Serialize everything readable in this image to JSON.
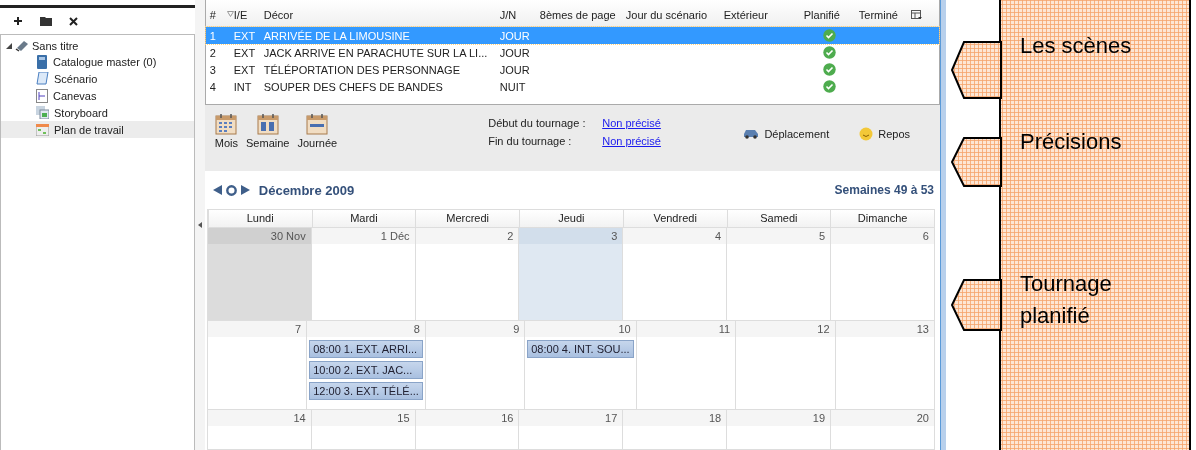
{
  "sidebar": {
    "tree": [
      {
        "label": "Sans titre",
        "expanded": true,
        "selected": false,
        "children": [
          {
            "label": "Catalogue master (0)",
            "kind": "catalog",
            "selected": false
          },
          {
            "label": "Scénario",
            "kind": "script",
            "selected": false
          },
          {
            "label": "Canevas",
            "kind": "canvas",
            "selected": false
          },
          {
            "label": "Storyboard",
            "kind": "storyboard",
            "selected": false
          },
          {
            "label": "Plan de travail",
            "kind": "schedule",
            "selected": true
          }
        ]
      }
    ]
  },
  "scenes": {
    "columns": [
      "#",
      "I/E",
      "Décor",
      "J/N",
      "8èmes de page",
      "Jour du scénario",
      "Extérieur",
      "Planifié",
      "Terminé"
    ],
    "rows": [
      {
        "number": "1",
        "ie": "EXT",
        "decor": "ARRIVÉE DE LA LIMOUSINE",
        "jn": "JOUR",
        "planned": true,
        "selected": true
      },
      {
        "number": "2",
        "ie": "EXT",
        "decor": "JACK ARRIVE EN PARACHUTE SUR LA LI...",
        "jn": "JOUR",
        "planned": true,
        "selected": false
      },
      {
        "number": "3",
        "ie": "EXT",
        "decor": "TÉLÉPORTATION DES PERSONNAGE",
        "jn": "JOUR",
        "planned": true,
        "selected": false
      },
      {
        "number": "4",
        "ie": "INT",
        "decor": "SOUPER DES CHEFS DE BANDES",
        "jn": "NUIT",
        "planned": true,
        "selected": false
      }
    ]
  },
  "toolbar": {
    "views": [
      {
        "label": "Mois",
        "kind": "month"
      },
      {
        "label": "Semaine",
        "kind": "week"
      },
      {
        "label": "Journée",
        "kind": "day"
      }
    ],
    "dates": [
      {
        "label": "Début du tournage :",
        "value": "Non précisé"
      },
      {
        "label": "Fin du tournage :",
        "value": "Non précisé"
      }
    ],
    "legend": [
      {
        "label": "Déplacement",
        "kind": "travel"
      },
      {
        "label": "Repos",
        "kind": "rest"
      }
    ]
  },
  "calendar": {
    "month": "Décembre 2009",
    "weeks_label": "Semaines 49 à 53",
    "days": [
      "Lundi",
      "Mardi",
      "Mercredi",
      "Jeudi",
      "Vendredi",
      "Samedi",
      "Dimanche"
    ],
    "weeks": [
      {
        "cells": [
          {
            "date": "30 Nov",
            "other_month": true,
            "today": false
          },
          {
            "date": "1 Déc",
            "other_month": false,
            "today": false
          },
          {
            "date": "2",
            "other_month": false,
            "today": false
          },
          {
            "date": "3",
            "other_month": false,
            "today": true
          },
          {
            "date": "4",
            "other_month": false,
            "today": false
          },
          {
            "date": "5",
            "other_month": false,
            "today": false
          },
          {
            "date": "6",
            "other_month": false,
            "today": false
          }
        ]
      },
      {
        "cells": [
          {
            "date": "7",
            "other_month": false,
            "today": false
          },
          {
            "date": "8",
            "other_month": false,
            "today": false,
            "events": [
              "08:00 1. EXT. ARRI...",
              "10:00 2. EXT. JAC...",
              "12:00 3. EXT. TÉLÉ..."
            ]
          },
          {
            "date": "9",
            "other_month": false,
            "today": false
          },
          {
            "date": "10",
            "other_month": false,
            "today": false,
            "events": [
              "08:00 4. INT. SOU..."
            ]
          },
          {
            "date": "11",
            "other_month": false,
            "today": false
          },
          {
            "date": "12",
            "other_month": false,
            "today": false
          },
          {
            "date": "13",
            "other_month": false,
            "today": false
          }
        ]
      },
      {
        "cells": [
          {
            "date": "14",
            "other_month": false,
            "today": false
          },
          {
            "date": "15",
            "other_month": false,
            "today": false
          },
          {
            "date": "16",
            "other_month": false,
            "today": false
          },
          {
            "date": "17",
            "other_month": false,
            "today": false
          },
          {
            "date": "18",
            "other_month": false,
            "today": false
          },
          {
            "date": "19",
            "other_month": false,
            "today": false
          },
          {
            "date": "20",
            "other_month": false,
            "today": false
          }
        ]
      }
    ]
  },
  "callouts": [
    {
      "text": "Les scènes"
    },
    {
      "text": "Précisions"
    },
    {
      "text": "Tournage planifié"
    }
  ]
}
